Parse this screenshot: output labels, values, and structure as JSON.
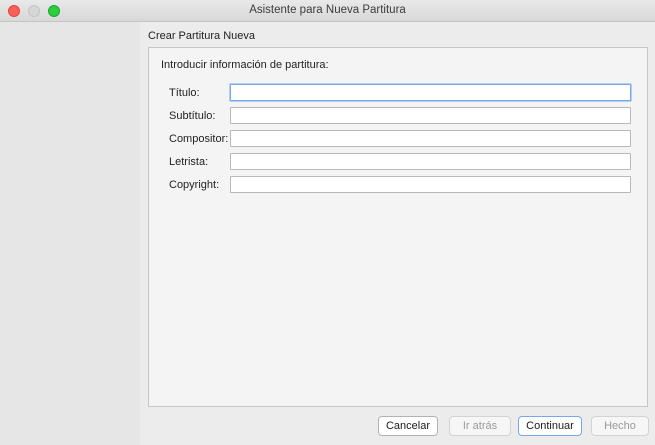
{
  "window": {
    "title": "Asistente para Nueva Partitura"
  },
  "header": {
    "title": "Crear Partitura Nueva"
  },
  "panel": {
    "heading": "Introducir información de partitura:",
    "fields": [
      {
        "label": "Título:",
        "value": "",
        "focused": true
      },
      {
        "label": "Subtítulo:",
        "value": ""
      },
      {
        "label": "Compositor:",
        "value": ""
      },
      {
        "label": "Letrista:",
        "value": ""
      },
      {
        "label": "Copyright:",
        "value": ""
      }
    ]
  },
  "buttons": {
    "cancel": "Cancelar",
    "back": "Ir atrás",
    "continue": "Continuar",
    "done": "Hecho"
  },
  "colors": {
    "close": "#fc5f57",
    "minimize": "#d6d6d6",
    "zoom": "#2ccd3f",
    "focus": "#7aa7e6"
  }
}
